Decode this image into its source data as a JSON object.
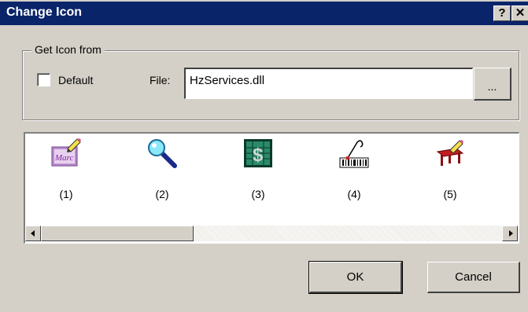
{
  "window": {
    "title": "Change Icon",
    "help_glyph": "?",
    "close_glyph": "✕"
  },
  "group": {
    "label": "Get Icon from",
    "default_checkbox": {
      "label": "Default",
      "checked": false
    },
    "file": {
      "label": "File:",
      "value": "HzServices.dll"
    },
    "browse_label": "..."
  },
  "icons": [
    {
      "caption": "(1)",
      "icon": "marc-record-icon"
    },
    {
      "caption": "(2)",
      "icon": "magnifier-icon"
    },
    {
      "caption": "(3)",
      "icon": "dollar-ledger-icon"
    },
    {
      "caption": "(4)",
      "icon": "barcode-scanner-icon"
    },
    {
      "caption": "(5)",
      "icon": "table-edit-icon"
    }
  ],
  "buttons": {
    "ok": "OK",
    "cancel": "Cancel"
  },
  "colors": {
    "titlebar": "#0a246a",
    "face": "#d4d0c8"
  }
}
